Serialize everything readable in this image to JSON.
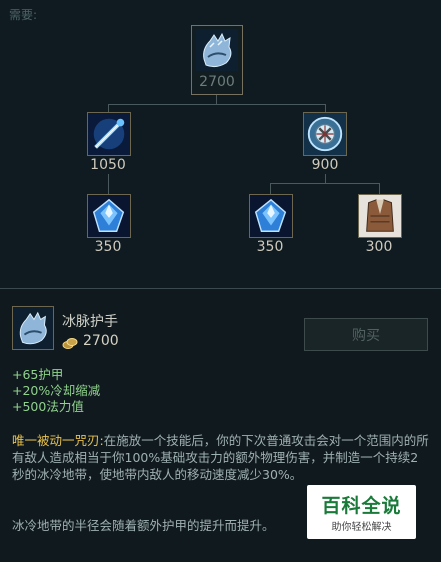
{
  "tree": {
    "requires_label": "需要:",
    "root": {
      "icon": "frost-gauntlet-icon",
      "price": "2700"
    },
    "mid_left": {
      "icon": "blue-wand-icon",
      "price": "1050"
    },
    "mid_right": {
      "icon": "glacial-shroud-icon",
      "price": "900"
    },
    "leaf1": {
      "icon": "blue-crystal-icon",
      "price": "350"
    },
    "leaf2": {
      "icon": "blue-crystal-icon",
      "price": "350"
    },
    "leaf3": {
      "icon": "cloth-armor-icon",
      "price": "300"
    }
  },
  "detail": {
    "name": "冰脉护手",
    "gold": "2700",
    "buy_label": "购买",
    "stats": [
      "+65护甲",
      "+20%冷却缩减",
      "+500法力值"
    ],
    "passive_name": "唯一被动一咒刃:",
    "passive_text": "在施放一个技能后，你的下次普通攻击会对一个范围内的所有敌人造成相当于你100%基础攻击力的额外物理伤害，并制造一个持续2秒的冰冷地带，使地带内敌人的移动速度减少30%。",
    "note": "冰冷地带的半径会随着额外护甲的提升而提升。"
  },
  "watermark": {
    "title": "百科全说",
    "subtitle": "助你轻松解决"
  },
  "colors": {
    "gold_text": "#e9c24f",
    "stat_green": "#8fd28c",
    "watermark_green": "#1a7a3a"
  }
}
